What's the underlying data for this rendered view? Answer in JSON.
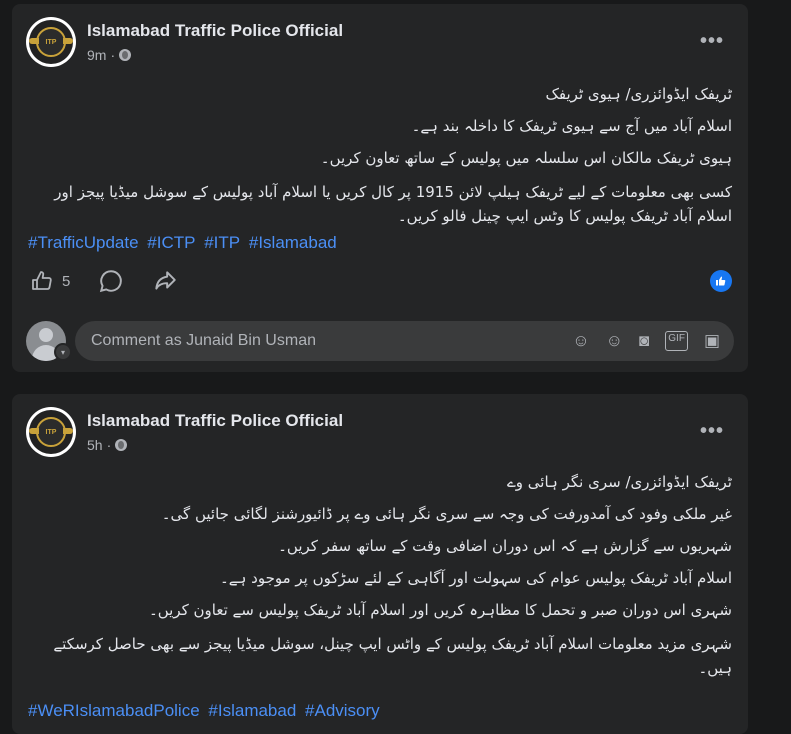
{
  "posts": [
    {
      "page_name": "Islamabad Traffic Police Official",
      "time": "9m",
      "logo_text": "ITP",
      "lines": [
        "ٹریفک ایڈوائزری/ ہیوی ٹریفک",
        "اسلام آباد میں آج سے ہیوی ٹریفک کا داخلہ بند ہے۔",
        "ہیوی ٹریفک مالکان اس سلسلہ میں پولیس کے ساتھ تعاون کریں۔",
        "کسی بھی معلومات کے لیے ٹریفک ہیلپ لائن 1915 پر کال کریں یا اسلام آباد پولیس کے سوشل میڈیا پیجز اور اسلام آباد ٹریفک پولیس کا وٹس ایپ چینل فالو کریں۔"
      ],
      "hashtags": [
        "#TrafficUpdate",
        "#ICTP",
        "#ITP",
        "#Islamabad"
      ],
      "like_count": "5",
      "comment_placeholder": "Comment as Junaid Bin Usman"
    },
    {
      "page_name": "Islamabad Traffic Police Official",
      "time": "5h",
      "logo_text": "ITP",
      "lines": [
        "ٹریفک ایڈوائزری/ سری نگر ہائی وے",
        "غیر ملکی وفود کی آمدورفت کی وجہ سے سری نگر ہائی وے پر ڈائیورشنز لگائی جائیں گی۔",
        "شہریوں سے گزارش ہے کہ اس دوران اضافی وقت کے ساتھ سفر کریں۔",
        "اسلام آباد ٹریفک پولیس عوام کی سہولت اور آگاہی کے لئے سڑکوں پر موجود ہے۔",
        "شہری اس دوران صبر و تحمل کا مظاہرہ کریں اور اسلام آباد ٹریفک پولیس سے تعاون کریں۔",
        "شہری مزید معلومات اسلام آباد ٹریفک پولیس کے واٹس ایپ چینل، سوشل میڈیا پیجز سے بھی حاصل کرسکتے ہیں۔"
      ],
      "hashtags": [
        "#WeRIslamabadPolice",
        "#Islamabad",
        "#Advisory"
      ]
    }
  ],
  "icons": {
    "more": "more-options-icon",
    "audience": "globe-icon",
    "like": "thumbs-up-icon",
    "comment": "comment-icon",
    "share": "share-icon",
    "reaction": "like-reaction-icon",
    "avatar_caret": "chevron-down-icon",
    "comment_tools": [
      "avatar-sticker-icon",
      "emoji-icon",
      "camera-icon",
      "gif-icon",
      "sticker-icon"
    ]
  },
  "colors": {
    "background": "#18191a",
    "card": "#242526",
    "hashtag": "#4b8ff5",
    "like_blue": "#1877f2"
  }
}
